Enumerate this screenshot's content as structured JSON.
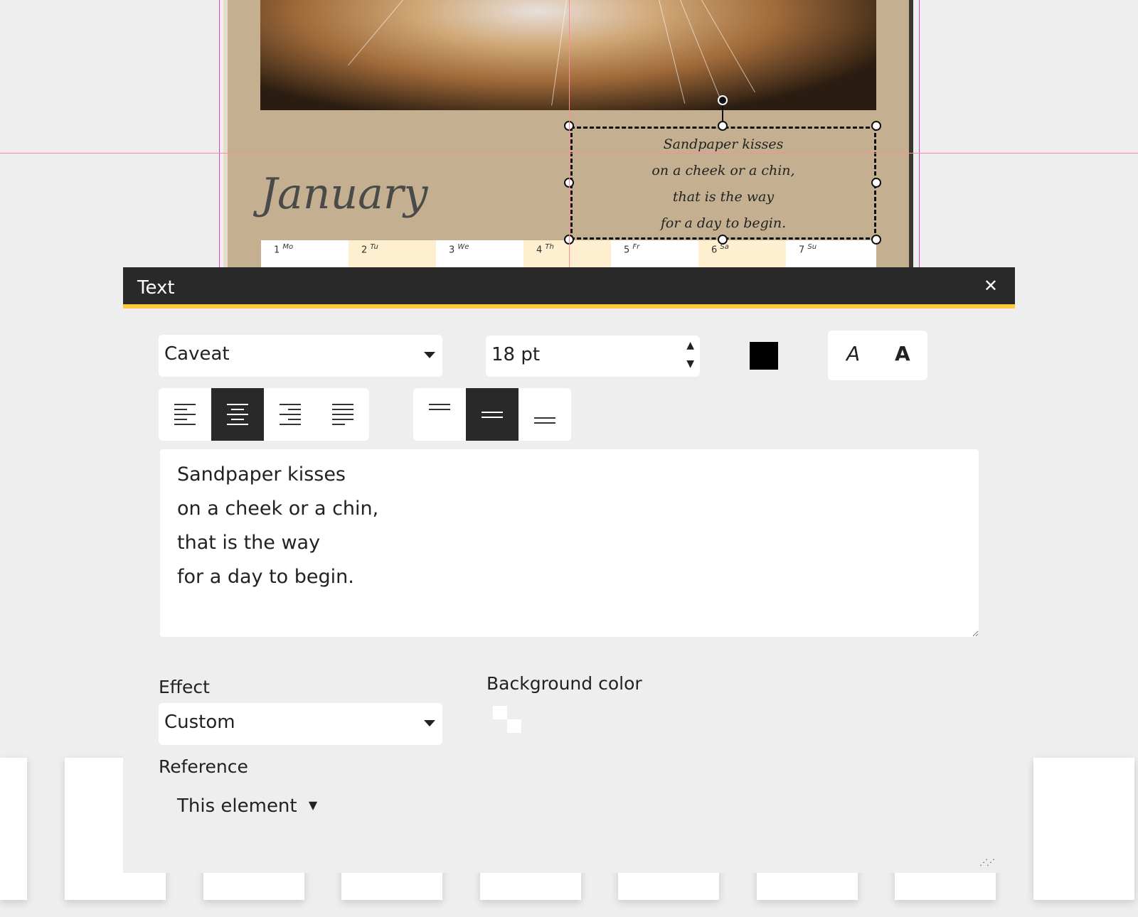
{
  "canvas": {
    "month": "January",
    "days": [
      {
        "num": "1",
        "abbr": "Mo"
      },
      {
        "num": "2",
        "abbr": "Tu"
      },
      {
        "num": "3",
        "abbr": "We"
      },
      {
        "num": "4",
        "abbr": "Th"
      },
      {
        "num": "5",
        "abbr": "Fr"
      },
      {
        "num": "6",
        "abbr": "Sa"
      },
      {
        "num": "7",
        "abbr": "Su"
      }
    ],
    "text_lines": [
      "Sandpaper kisses",
      "on a cheek or a chin,",
      "that is the way",
      "for a day to begin."
    ]
  },
  "panel": {
    "title": "Text",
    "close_icon": "close-icon",
    "font": "Caveat",
    "size": "18 pt",
    "text_color": "#000000",
    "style_italic": "A",
    "style_bold": "A",
    "align_selected": "center",
    "valign_selected": "middle",
    "text": "Sandpaper kisses\non a cheek or a chin,\nthat is the way\nfor a day to begin.",
    "effect_label": "Effect",
    "effect_value": "Custom",
    "bg_label": "Background color",
    "reference_label": "Reference",
    "reference_value": "This element",
    "accent": "#ffc83d"
  }
}
